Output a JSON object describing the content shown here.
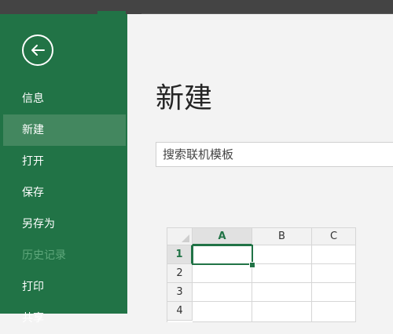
{
  "nav": {
    "items": [
      {
        "label": "信息"
      },
      {
        "label": "新建"
      },
      {
        "label": "打开"
      },
      {
        "label": "保存"
      },
      {
        "label": "另存为"
      },
      {
        "label": "历史记录"
      },
      {
        "label": "打印"
      },
      {
        "label": "共享"
      }
    ]
  },
  "main": {
    "title": "新建",
    "search_value": "搜索联机模板"
  },
  "template_preview": {
    "columns": [
      "A",
      "B",
      "C"
    ],
    "rows": [
      "1",
      "2",
      "3",
      "4"
    ]
  },
  "colors": {
    "accent": "#217346",
    "sidebar_selected": "#43875f",
    "background": "#f3f3f3"
  }
}
